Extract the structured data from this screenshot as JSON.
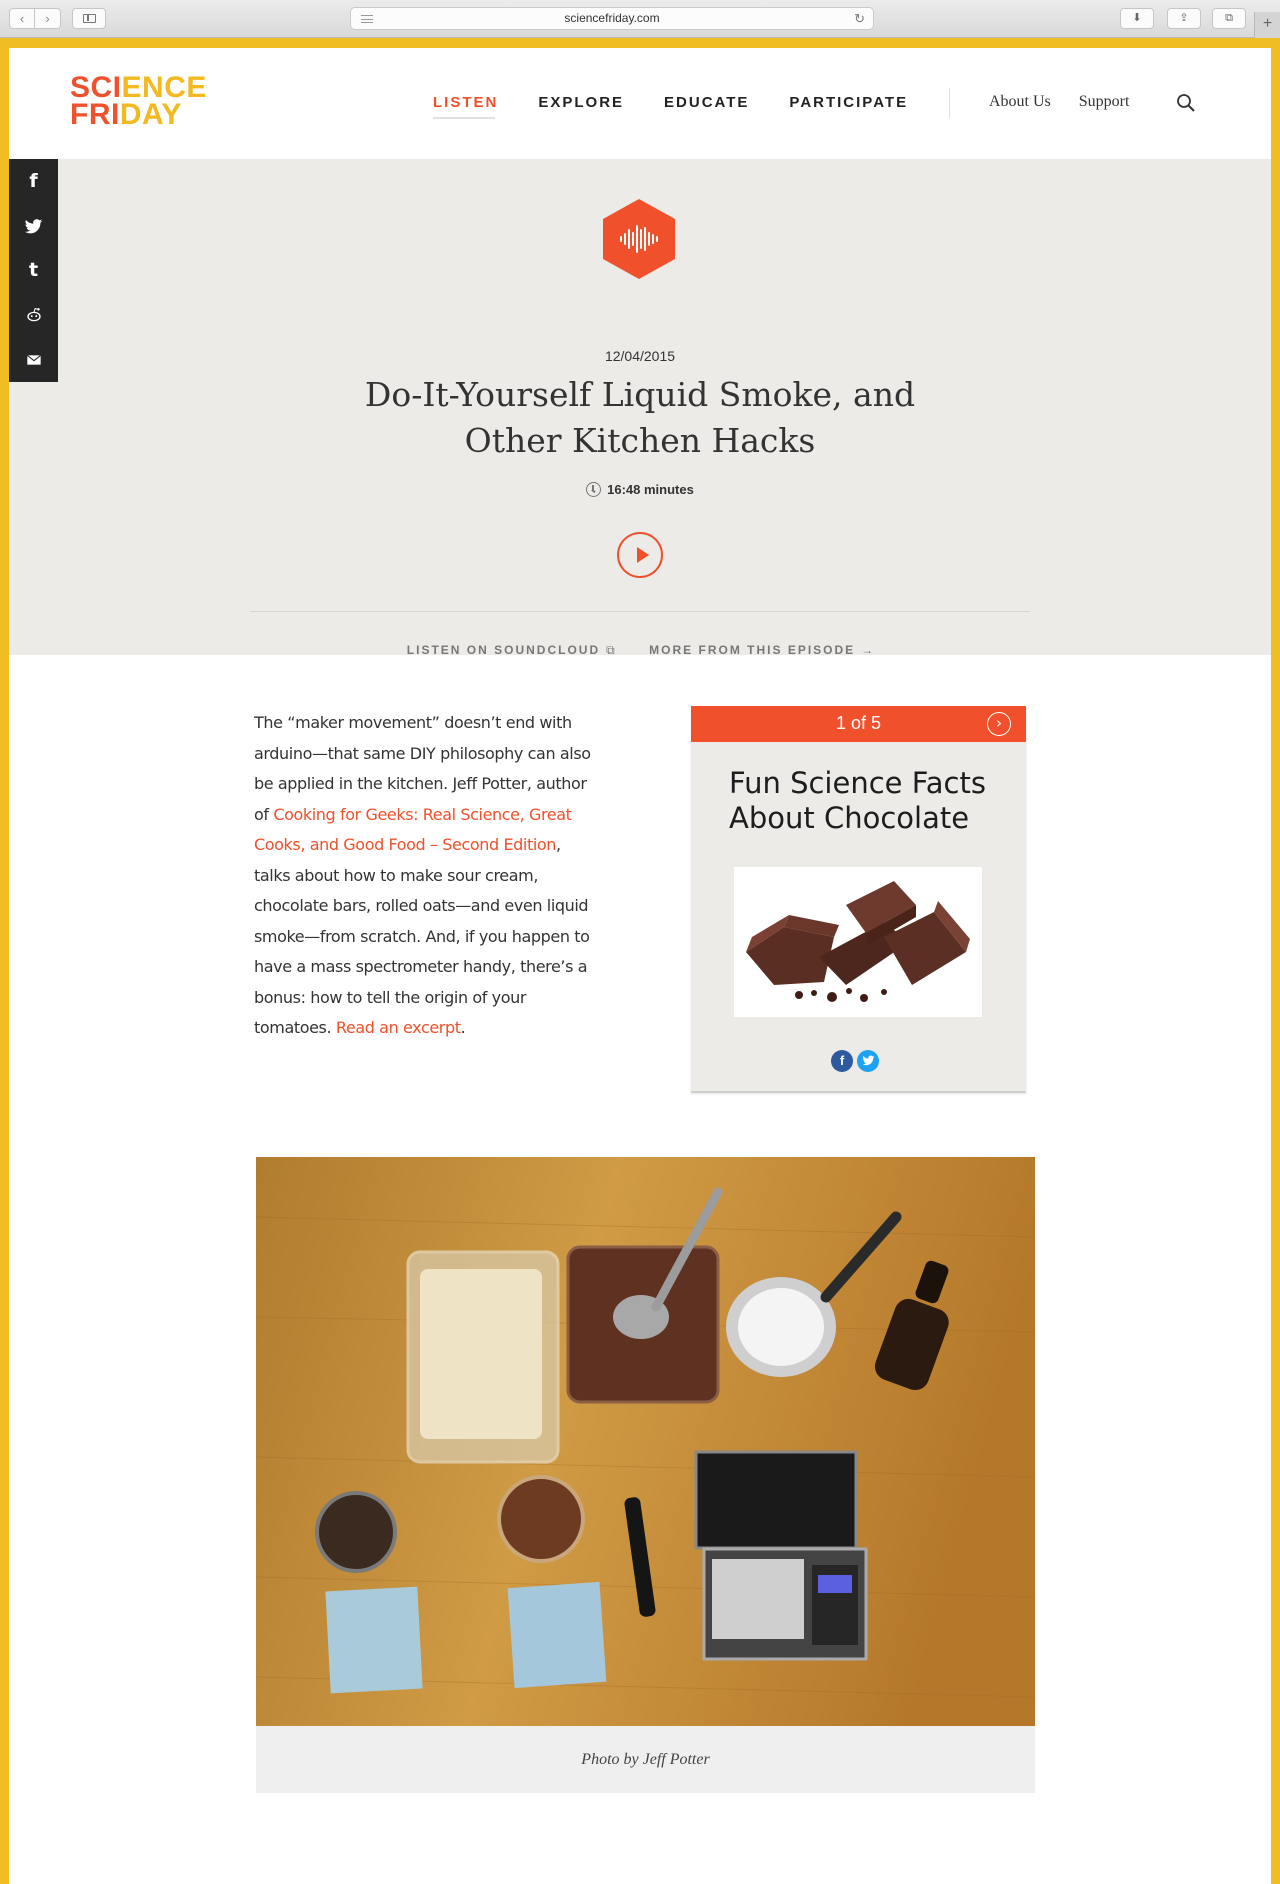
{
  "browser": {
    "url": "sciencefriday.com"
  },
  "brand": {
    "logo_line1_a": "SCI",
    "logo_line1_b": "ENCE",
    "logo_line2_a": "FRI",
    "logo_line2_b": "DAY",
    "accent_color": "#f0502b",
    "secondary_color": "#f3b920"
  },
  "nav": {
    "main": [
      "LISTEN",
      "EXPLORE",
      "EDUCATE",
      "PARTICIPATE"
    ],
    "active": "LISTEN",
    "secondary": [
      "About Us",
      "Support"
    ]
  },
  "share": {
    "icons": [
      "facebook-icon",
      "twitter-icon",
      "tumblr-icon",
      "reddit-icon",
      "email-icon"
    ]
  },
  "episode": {
    "date": "12/04/2015",
    "title": "Do-It-Yourself Liquid Smoke, and Other Kitchen Hacks",
    "duration": "16:48 minutes",
    "listen_link": "LISTEN ON SOUNDCLOUD",
    "more_link": "MORE FROM THIS EPISODE"
  },
  "article": {
    "p_start": "The “maker movement” doesn’t end with arduino—that same DIY philosophy can also be applied in the kitchen. Jeff Potter, author of ",
    "book_link": "Cooking for Geeks: Real Science, Great Cooks, and Good Food – Second Edition",
    "p_middle": ", talks about how to make sour cream, chocolate bars, rolled oats—and even liquid smoke—from scratch. And, if you happen to have a mass spectrometer handy, there’s a bonus: how to tell the origin of your tomatoes. ",
    "excerpt_link": "Read an excerpt",
    "p_end": "."
  },
  "widget": {
    "counter": "1 of 5",
    "title": "Fun Science Facts About Chocolate",
    "next_icon": "chevron-right-icon"
  },
  "photo": {
    "caption": "Photo by Jeff Potter"
  }
}
